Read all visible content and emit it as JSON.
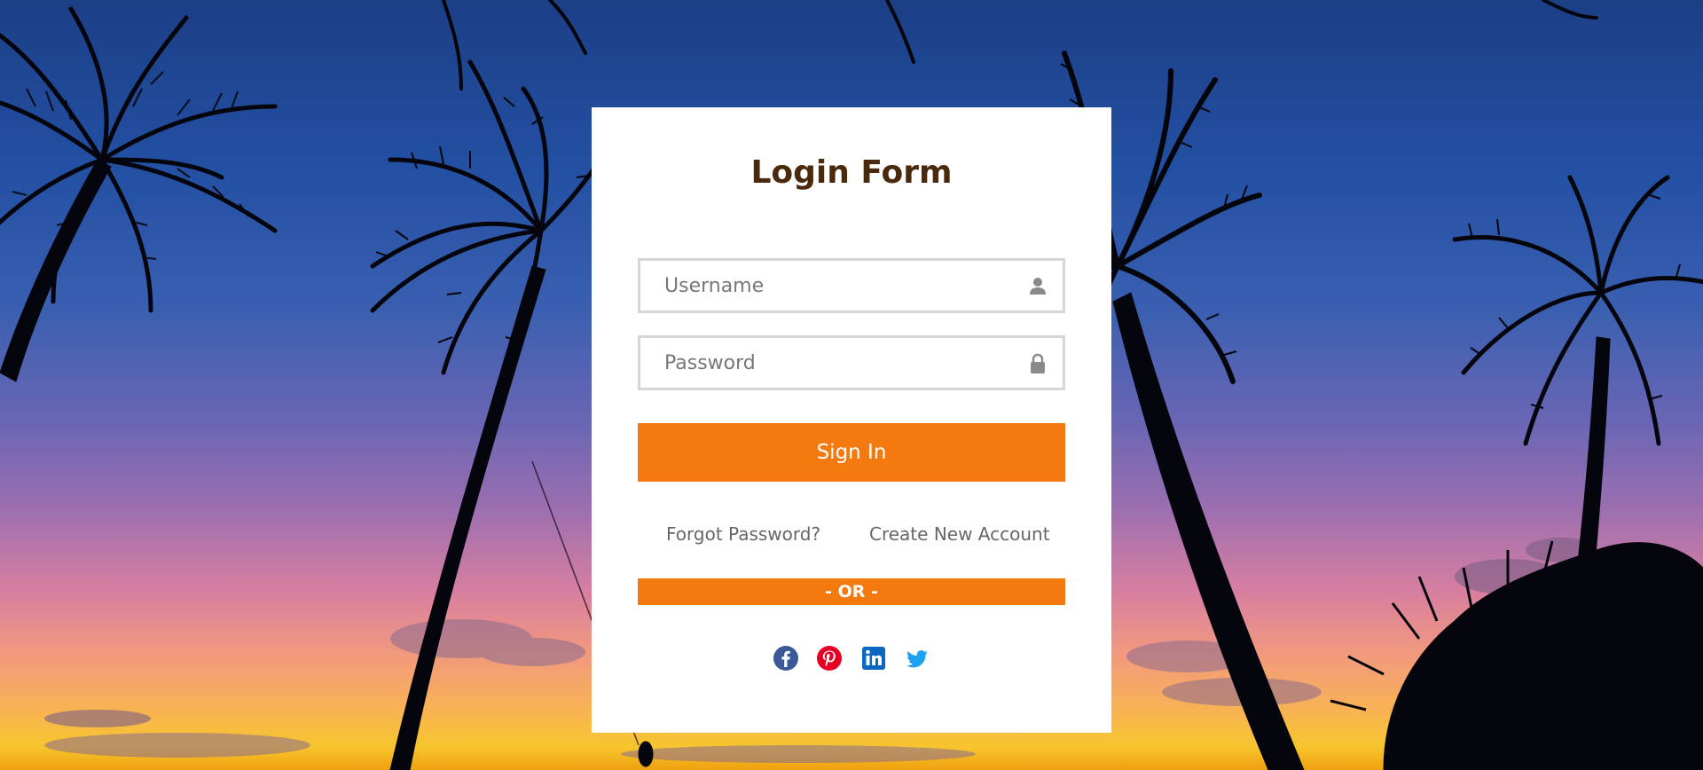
{
  "login_form": {
    "title": "Login Form",
    "username_placeholder": "Username",
    "password_placeholder": "Password",
    "signin_label": "Sign In",
    "forgot_password_label": "Forgot Password?",
    "create_account_label": "Create New Account",
    "divider_label": "- OR -",
    "accent_color": "#f47a10",
    "title_color": "#4a2a0d"
  },
  "social": [
    {
      "name": "facebook-icon",
      "color": "#3b5998"
    },
    {
      "name": "pinterest-icon",
      "color": "#e60023"
    },
    {
      "name": "linkedin-icon",
      "color": "#0a66c2"
    },
    {
      "name": "twitter-icon",
      "color": "#1da1f2"
    }
  ]
}
